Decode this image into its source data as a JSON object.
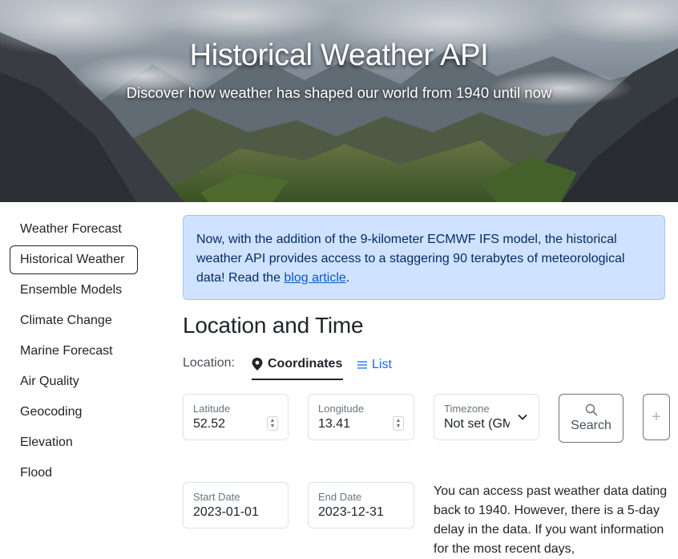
{
  "hero": {
    "title": "Historical Weather API",
    "subtitle": "Discover how weather has shaped our world from 1940 until now"
  },
  "sidebar": {
    "items": [
      {
        "label": "Weather Forecast",
        "active": false
      },
      {
        "label": "Historical Weather",
        "active": true
      },
      {
        "label": "Ensemble Models",
        "active": false
      },
      {
        "label": "Climate Change",
        "active": false
      },
      {
        "label": "Marine Forecast",
        "active": false
      },
      {
        "label": "Air Quality",
        "active": false
      },
      {
        "label": "Geocoding",
        "active": false
      },
      {
        "label": "Elevation",
        "active": false
      },
      {
        "label": "Flood",
        "active": false
      }
    ]
  },
  "alert": {
    "text_before": "Now, with the addition of the 9-kilometer ECMWF IFS model, the historical weather API provides access to a staggering 90 terabytes of meteorological data! Read the ",
    "link": "blog article",
    "text_after": "."
  },
  "location": {
    "section_title": "Location and Time",
    "label": "Location:",
    "tab_coordinates": "Coordinates",
    "tab_list": "List"
  },
  "fields": {
    "latitude": {
      "label": "Latitude",
      "value": "52.52"
    },
    "longitude": {
      "label": "Longitude",
      "value": "13.41"
    },
    "timezone": {
      "label": "Timezone",
      "value": "Not set (GM"
    },
    "search_label": "Search",
    "start_date": {
      "label": "Start Date",
      "value": "2023-01-01"
    },
    "end_date": {
      "label": "End Date",
      "value": "2023-12-31"
    }
  },
  "info": {
    "text": "You can access past weather data dating back to 1940. However, there is a 5-day delay in the data. If you want information for the most recent days,"
  },
  "colors": {
    "alert_bg": "#cfe2ff",
    "link": "#0d6efd",
    "text": "#212529"
  },
  "icons": {
    "coordinates_tab": "map-pin-icon",
    "list_tab": "list-icon",
    "search": "search-icon",
    "add": "plus-icon",
    "timezone": "chevron-down-icon"
  }
}
